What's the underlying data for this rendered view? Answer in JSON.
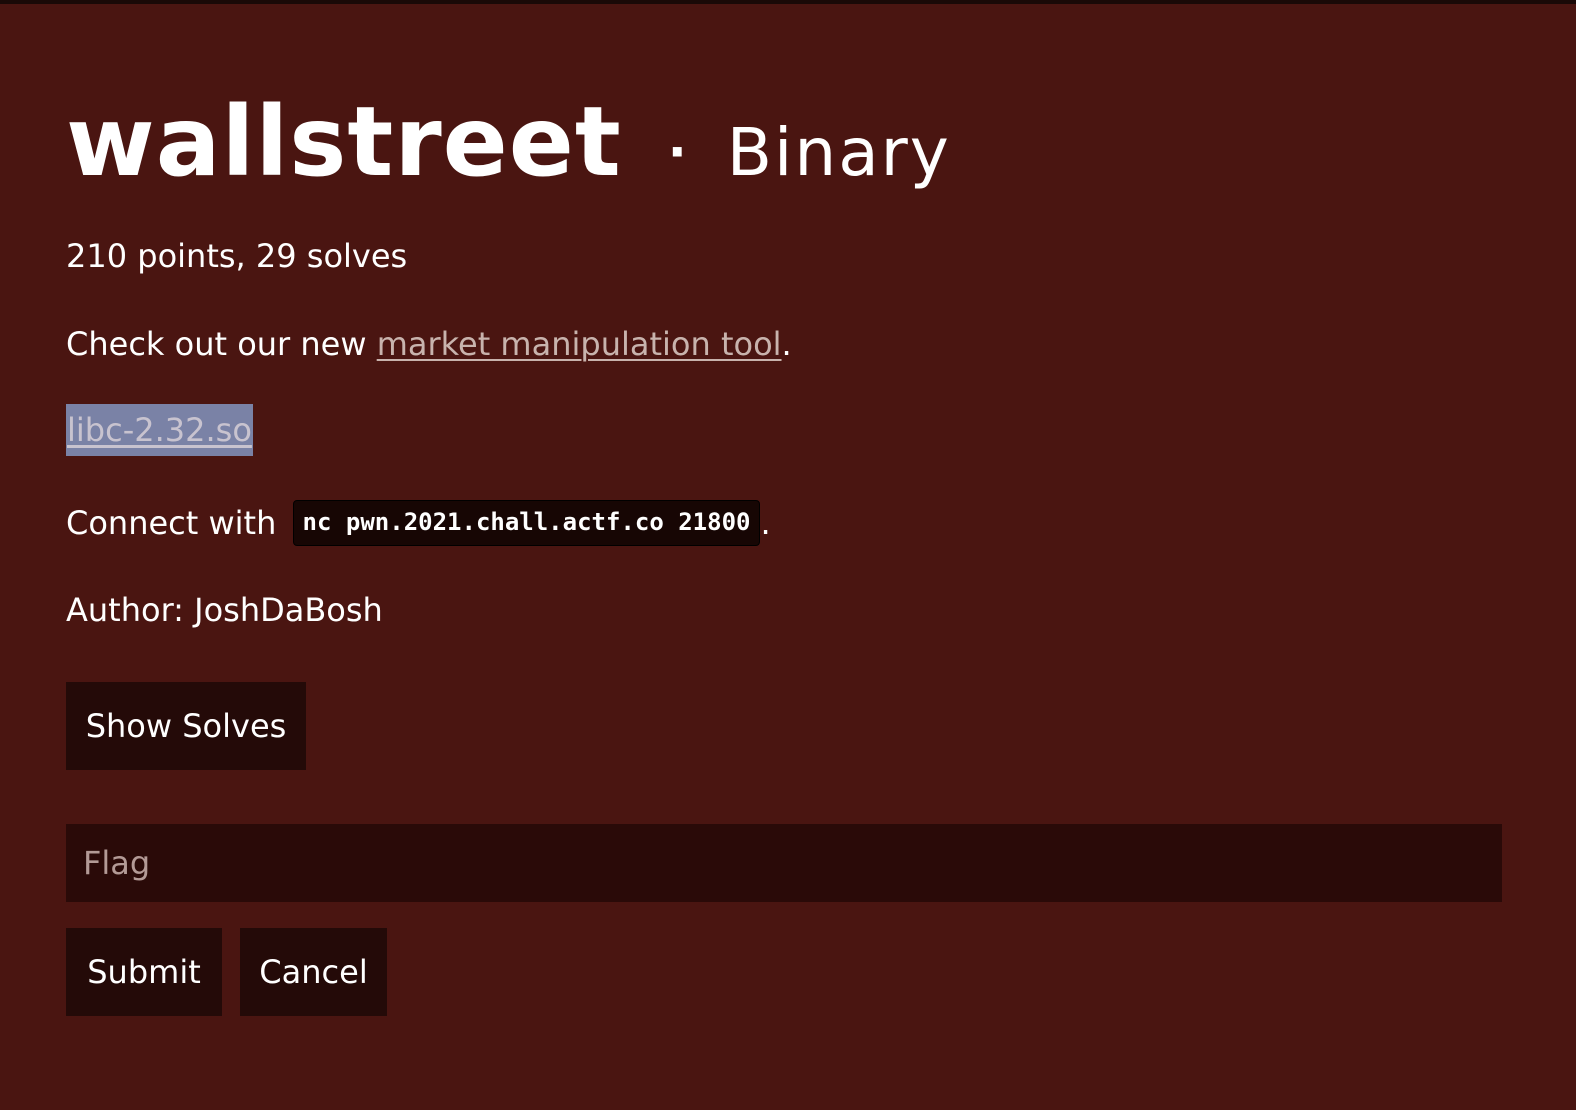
{
  "challenge": {
    "name": "wallstreet",
    "separator": "·",
    "category": "Binary",
    "stats": "210 points, 29 solves",
    "description_prefix": "Check out our new ",
    "description_link": "market manipulation tool",
    "description_suffix": ".",
    "file_link": "libc-2.32.so",
    "connect_prefix": "Connect with ",
    "connect_command": "nc pwn.2021.chall.actf.co 21800",
    "connect_suffix": ".",
    "author": "Author: JoshDaBosh"
  },
  "actions": {
    "show_solves_label": "Show Solves",
    "flag_placeholder": "Flag",
    "flag_value": "",
    "submit_label": "Submit",
    "cancel_label": "Cancel"
  },
  "colors": {
    "background": "#4a1511",
    "button_background": "#240a08",
    "input_background": "#2a0a08",
    "link": "#c8b3ad",
    "file_link_highlight": "#7a82a6"
  }
}
